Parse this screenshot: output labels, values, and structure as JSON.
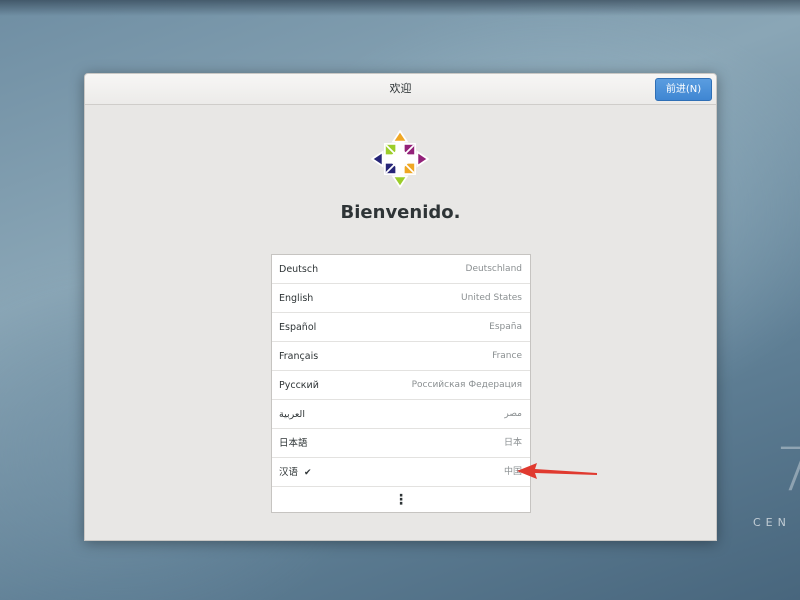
{
  "window": {
    "title": "欢迎",
    "next_label": "前进(N)"
  },
  "welcome": {
    "heading": "Bienvenido."
  },
  "languages": [
    {
      "name": "Deutsch",
      "region": "Deutschland",
      "selected": false
    },
    {
      "name": "English",
      "region": "United States",
      "selected": false
    },
    {
      "name": "Español",
      "region": "España",
      "selected": false
    },
    {
      "name": "Français",
      "region": "France",
      "selected": false
    },
    {
      "name": "Русский",
      "region": "Российская Федерация",
      "selected": false
    },
    {
      "name": "العربية",
      "region": "مصر",
      "selected": false
    },
    {
      "name": "日本語",
      "region": "日本",
      "selected": false
    },
    {
      "name": "汉语",
      "region": "中国",
      "selected": true
    }
  ],
  "more_icon": "⋮",
  "check_glyph": "✔",
  "brand": {
    "seven": "7",
    "text": "CEN"
  },
  "colors": {
    "accent": "#3f86d2",
    "annotation_arrow": "#e03a2f"
  },
  "icons": {
    "logo": "centos-logo-icon",
    "more": "more-options-icon",
    "check": "checkmark-icon",
    "arrow": "red-arrow-annotation-icon"
  }
}
